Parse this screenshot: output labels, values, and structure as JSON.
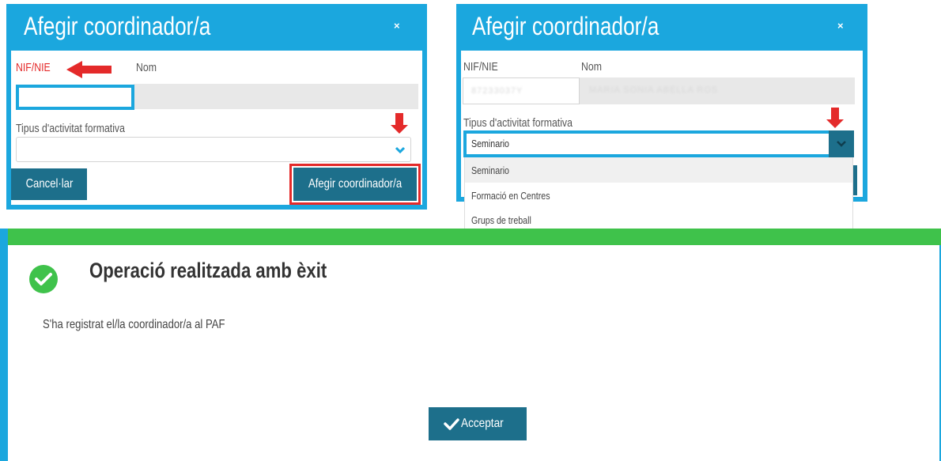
{
  "dialog1": {
    "title": "Afegir coordinador/a",
    "close_icon": "×",
    "nif_label": "NIF/NIE",
    "name_label": "Nom",
    "activity_label": "Tipus d'activitat formativa",
    "cancel_label": "Cancel·lar",
    "submit_label": "Afegir coordinador/a"
  },
  "dialog2": {
    "title": "Afegir coordinador/a",
    "close_icon": "×",
    "nif_label": "NIF/NIE",
    "name_label": "Nom",
    "nif_value": "87233037Y",
    "name_value": "MARIA SONIA ABELLA ROS",
    "activity_label": "Tipus d'activitat formativa",
    "select_value": "Seminario",
    "options": [
      "Seminario",
      "Formació en Centres",
      "Grups de treball"
    ]
  },
  "success": {
    "title": "Operació realitzada amb èxit",
    "message": "S'ha registrat el/la coordinador/a al PAF",
    "accept_label": "Acceptar"
  },
  "colors": {
    "header_blue": "#1ba7de",
    "button_dark": "#1d6f8b",
    "success_green": "#3fc24b",
    "highlight_red": "#e42a2a"
  }
}
